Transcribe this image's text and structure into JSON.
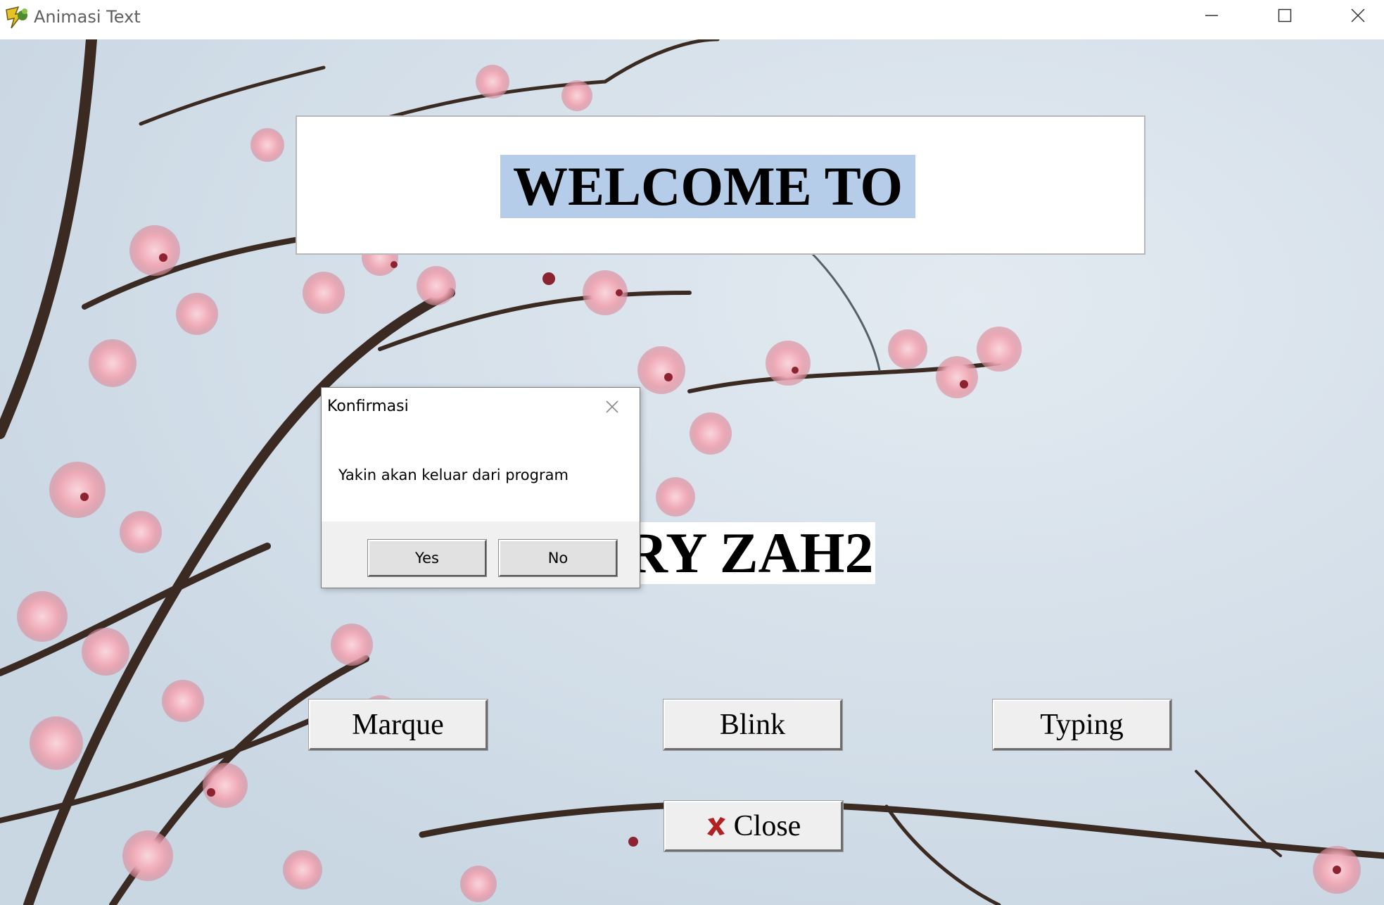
{
  "window": {
    "title": "Animasi Text",
    "app_icon": "delphi-helmet-icon",
    "controls": {
      "minimize_icon": "minimize-icon",
      "maximize_icon": "maximize-icon",
      "close_icon": "close-icon"
    }
  },
  "main": {
    "welcome_text": "WELCOME TO",
    "library_text": "MY LIBRARY ZAH2",
    "welcome_highlight_color": "#b5cde8",
    "buttons": {
      "marque": "Marque",
      "blink": "Blink",
      "typing": "Typing",
      "close": "Close",
      "close_icon": "red-x-icon"
    }
  },
  "dialog": {
    "title": "Konfirmasi",
    "message": "Yakin akan keluar dari program",
    "yes_label": "Yes",
    "no_label": "No",
    "close_icon": "close-icon"
  },
  "colors": {
    "close_icon": "#b22222",
    "blossom": "#f2b9c3",
    "branch": "#3c2a22",
    "sky": "#d4e0ea"
  }
}
